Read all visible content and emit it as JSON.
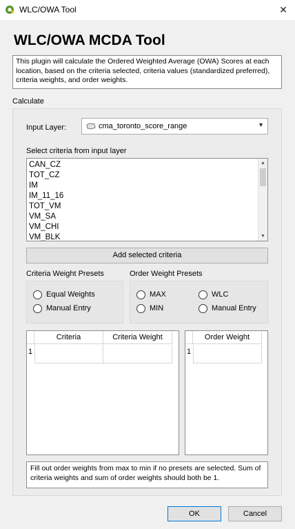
{
  "window": {
    "title": "WLC/OWA Tool",
    "close_glyph": "✕"
  },
  "heading": "WLC/OWA  MCDA Tool",
  "description": "This plugin will calculate the Ordered Weighted Average (OWA) Scores at each location, based on the criteria selected, criteria values (standardized preferred), criteria weights, and order weights.",
  "calculate_label": "Calculate",
  "input_layer": {
    "label": "Input Layer:",
    "value": "cma_toronto_score_range",
    "icon": "polygon-layer-icon"
  },
  "criteria_list": {
    "label": "Select criteria from input layer",
    "items": [
      "CAN_CZ",
      "TOT_CZ",
      "IM",
      "IM_11_16",
      "TOT_VM",
      "VM_SA",
      "VM_CHI",
      "VM_BLK"
    ]
  },
  "add_button": "Add selected criteria",
  "criteria_weight_presets": {
    "title": "Criteria Weight Presets",
    "options": [
      "Equal Weights",
      "Manual Entry"
    ]
  },
  "order_weight_presets": {
    "title": "Order Weight Presets",
    "options": [
      "MAX",
      "WLC",
      "MIN",
      "Manual Entry"
    ]
  },
  "criteria_table": {
    "headers": [
      "Criteria",
      "Criteria Weight"
    ],
    "row_numbers": [
      "1"
    ]
  },
  "order_table": {
    "headers": [
      "Order Weight"
    ],
    "row_numbers": [
      "1"
    ]
  },
  "footer_note": "Fill out order weights from max to min if no presets are selected. Sum of criteria weights and sum of order weights should both be 1.",
  "buttons": {
    "ok": "OK",
    "cancel": "Cancel"
  },
  "colors": {
    "qgis_green": "#589632",
    "default_button_border": "#0078d7"
  }
}
